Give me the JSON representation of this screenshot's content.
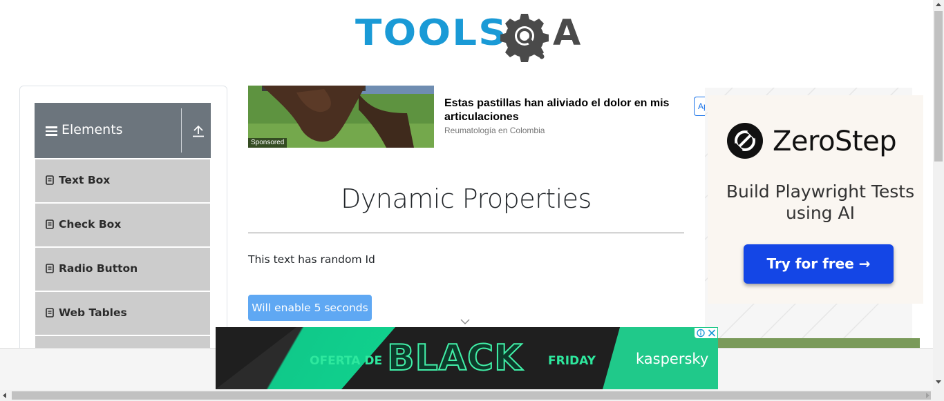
{
  "header": {
    "logo_text_left": "TOOLS",
    "logo_text_right": "A",
    "logo_colors": {
      "tools": "#1a9ad6",
      "qa": "#4a4a4a"
    }
  },
  "sidebar": {
    "group_title": "Elements",
    "group_icon": "hamburger-icon",
    "toggle_icon": "collapse-arrow-icon",
    "items": [
      {
        "label": "Text Box",
        "icon": "list-icon"
      },
      {
        "label": "Check Box",
        "icon": "list-icon"
      },
      {
        "label": "Radio Button",
        "icon": "list-icon"
      },
      {
        "label": "Web Tables",
        "icon": "list-icon"
      },
      {
        "label": "",
        "icon": "list-icon"
      }
    ]
  },
  "sponsored_ad": {
    "tag": "Sponsored",
    "title": "Estas pastillas han aliviado el dolor en mis articulaciones",
    "source": "Reumatología en Colombia",
    "cta_partial": "Ap"
  },
  "main": {
    "title": "Dynamic Properties",
    "random_id_text": "This text has random Id",
    "enable_button": "Will enable 5 seconds"
  },
  "right_ad": {
    "brand": "ZeroStep",
    "tagline": "Build Playwright Tests using AI",
    "cta": "Try for free →"
  },
  "bottom_ad": {
    "left_text": "OFERTA DE",
    "big_text": "BLACK",
    "right_text": "FRIDAY",
    "brand": "kaspersky",
    "colors": {
      "accent": "#2ee89e",
      "background": "#1f1f1f"
    }
  },
  "colors": {
    "sidebar_header_bg": "#6c757d",
    "sidebar_item_bg": "#cccccc",
    "enable_button_bg": "#5fa8f3",
    "zerostep_button_bg": "#1446e6"
  }
}
